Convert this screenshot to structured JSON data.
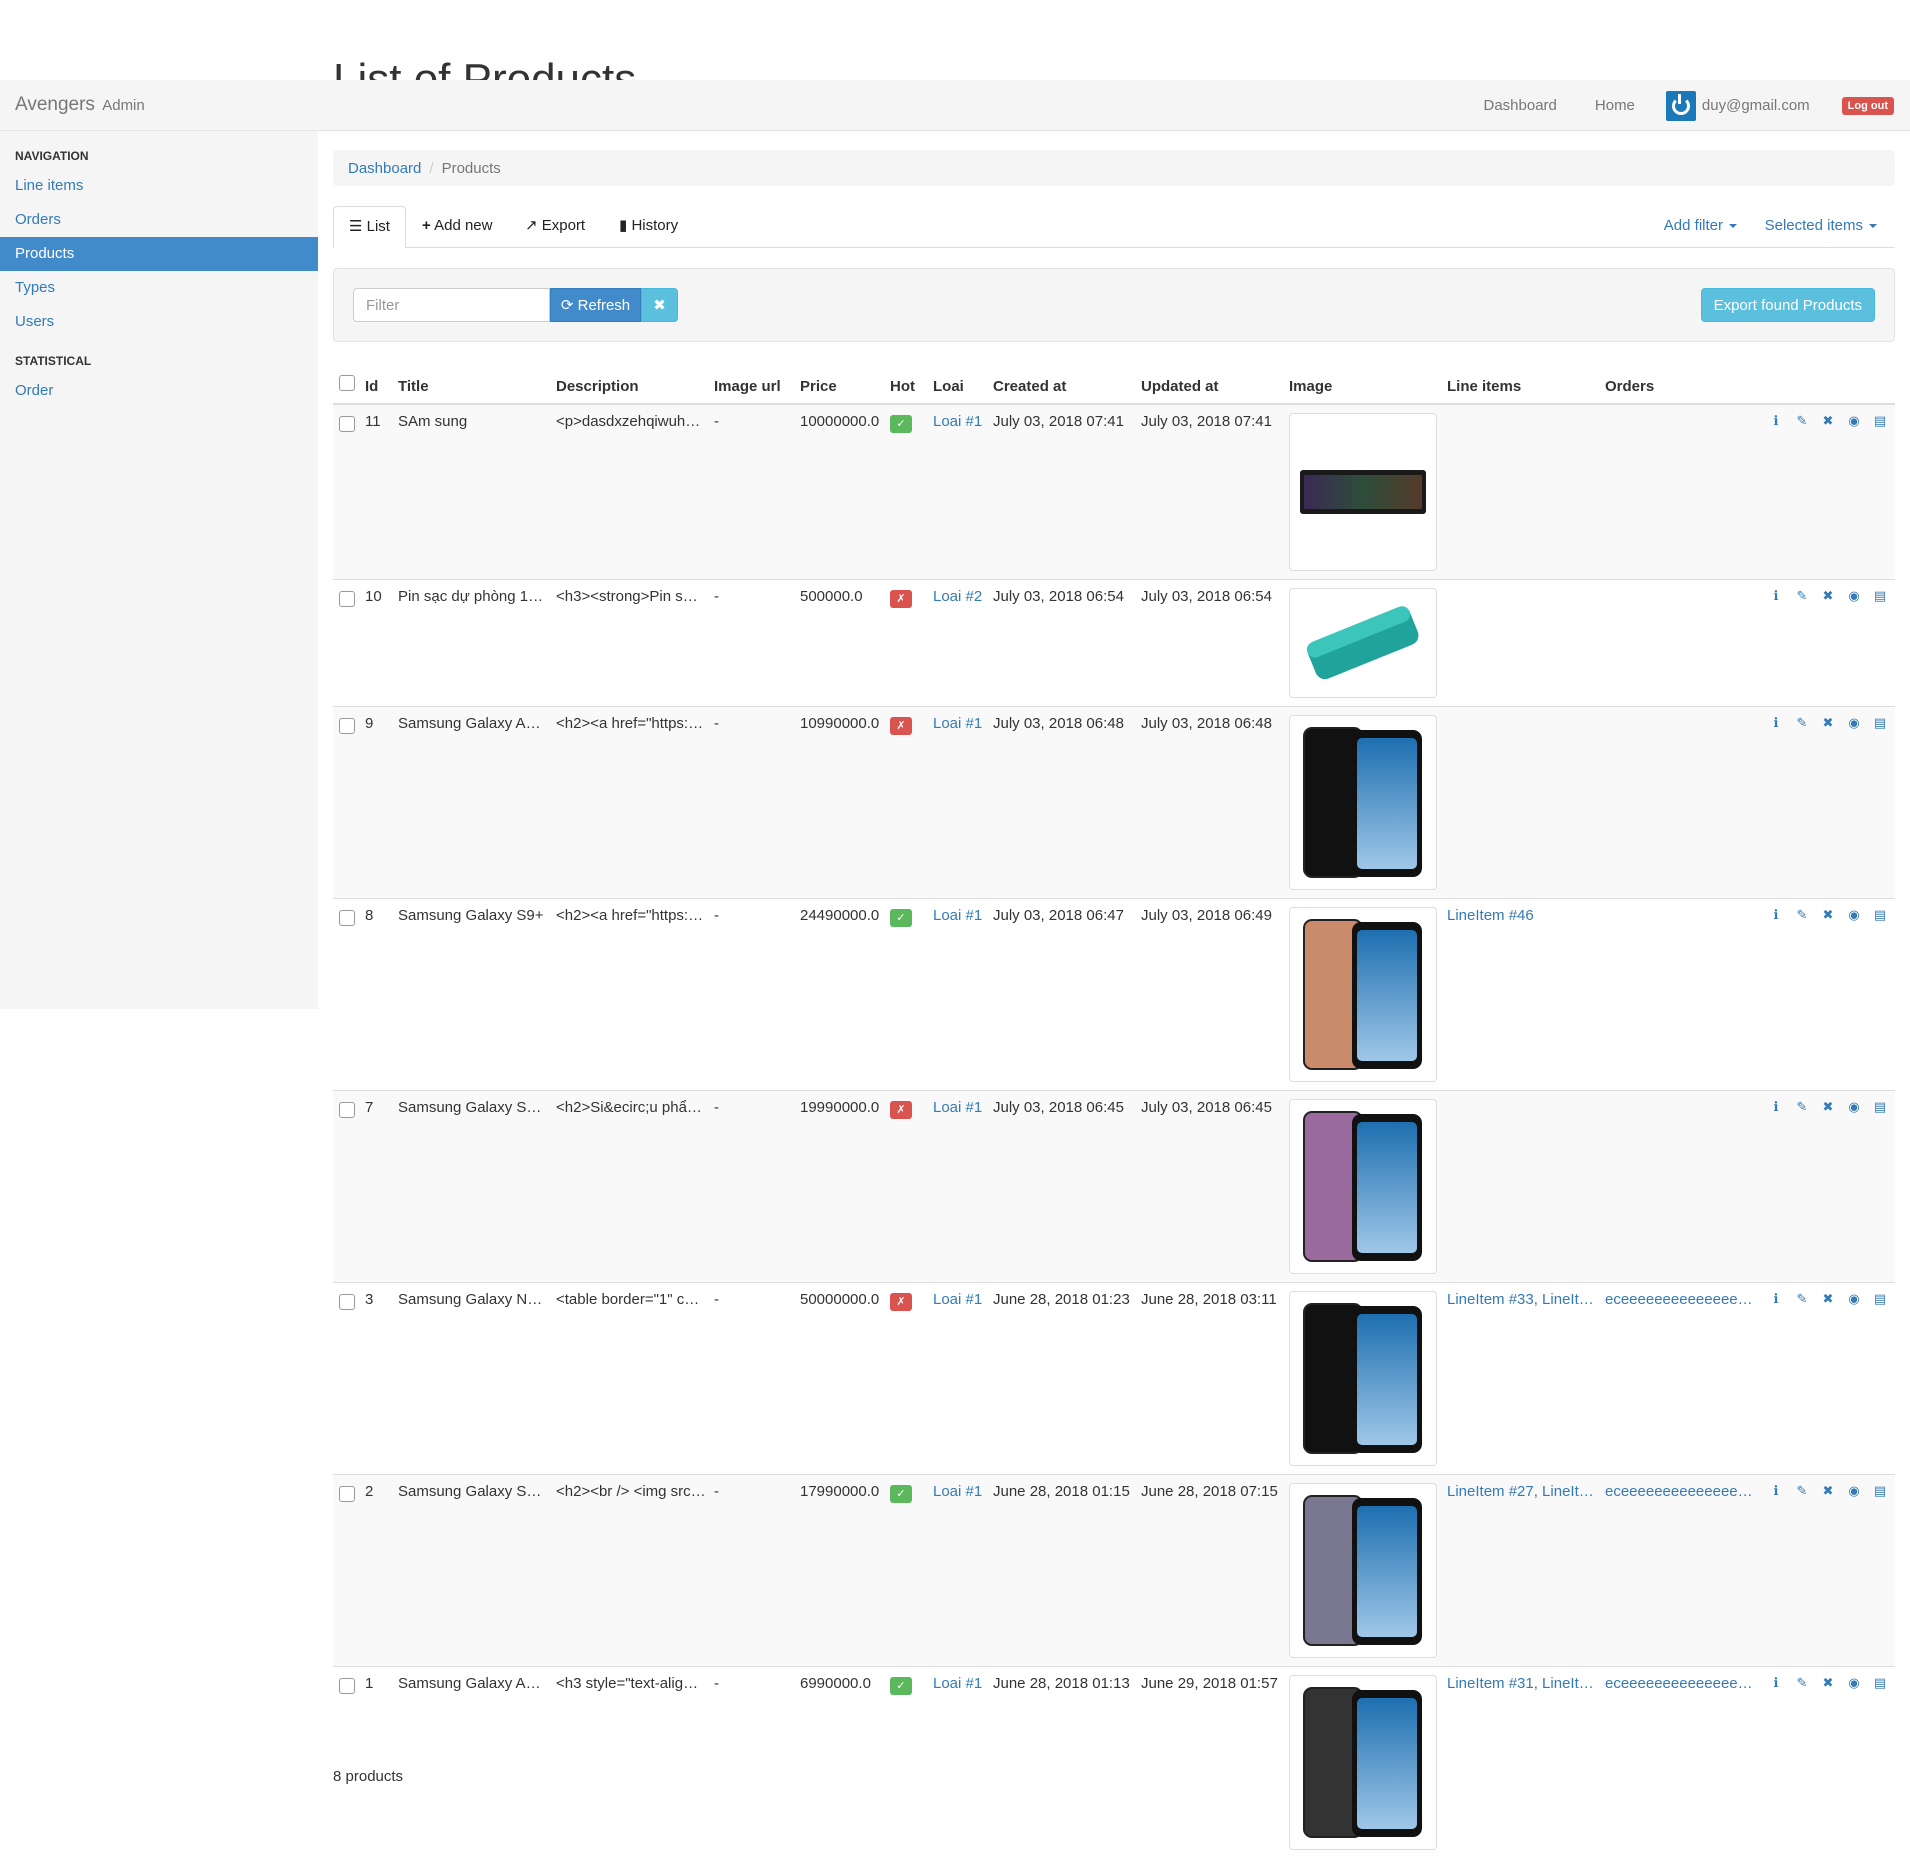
{
  "page": {
    "heading": "List of Products",
    "footer_count": "8 products"
  },
  "navbar": {
    "brand": "Avengers",
    "brand_small": "Admin",
    "links": [
      "Dashboard",
      "Home"
    ],
    "user_email": "duy@gmail.com",
    "logout_label": "Log out"
  },
  "sidebar": {
    "nav_header": "NAVIGATION",
    "items": [
      {
        "label": "Line items",
        "active": false
      },
      {
        "label": "Orders",
        "active": false
      },
      {
        "label": "Products",
        "active": true
      },
      {
        "label": "Types",
        "active": false
      },
      {
        "label": "Users",
        "active": false
      }
    ],
    "stat_header": "STATISTICAL",
    "stat_items": [
      {
        "label": "Order"
      }
    ]
  },
  "breadcrumb": {
    "root": "Dashboard",
    "current": "Products"
  },
  "tabs": {
    "list": "List",
    "add_new": "Add new",
    "export": "Export",
    "history": "History",
    "add_filter": "Add filter",
    "selected_items": "Selected items"
  },
  "filter": {
    "placeholder": "Filter",
    "refresh_label": "Refresh",
    "clear_label": "✖",
    "export_label": "Export found Products"
  },
  "table": {
    "columns": [
      "Id",
      "Title",
      "Description",
      "Image url",
      "Price",
      "Hot",
      "Loai",
      "Created at",
      "Updated at",
      "Image",
      "Line items",
      "Orders"
    ],
    "rows": [
      {
        "id": "11",
        "title": "SAm sung",
        "description": "<p>dasdxzehqiwuhe…",
        "image_url": "-",
        "price": "10000000.0",
        "hot": true,
        "loai": "Loai #1",
        "created": "July 03, 2018 07:41",
        "updated": "July 03, 2018 07:41",
        "image": "keyboard",
        "line_items": "",
        "orders": ""
      },
      {
        "id": "10",
        "title": "Pin sạc dự phòng 10…",
        "description": "<h3><strong>Pin sạ…",
        "image_url": "-",
        "price": "500000.0",
        "hot": false,
        "loai": "Loai #2",
        "created": "July 03, 2018 06:54",
        "updated": "July 03, 2018 06:54",
        "image": "powerbank",
        "line_items": "",
        "orders": ""
      },
      {
        "id": "9",
        "title": "Samsung Galaxy A8 …",
        "description": "<h2><a href=\"https://…",
        "image_url": "-",
        "price": "10990000.0",
        "hot": false,
        "loai": "Loai #1",
        "created": "July 03, 2018 06:48",
        "updated": "July 03, 2018 06:48",
        "image": "phone-black-blue",
        "line_items": "",
        "orders": ""
      },
      {
        "id": "8",
        "title": "Samsung Galaxy S9+",
        "description": "<h2><a href=\"https://…",
        "image_url": "-",
        "price": "24490000.0",
        "hot": true,
        "loai": "Loai #1",
        "created": "July 03, 2018 06:47",
        "updated": "July 03, 2018 06:49",
        "image": "phone-gold",
        "line_items": "LineItem #46",
        "orders": ""
      },
      {
        "id": "7",
        "title": "Samsung Galaxy S9 …",
        "description": "<h2>Si&ecirc;u phẩ…",
        "image_url": "-",
        "price": "19990000.0",
        "hot": false,
        "loai": "Loai #1",
        "created": "July 03, 2018 06:45",
        "updated": "July 03, 2018 06:45",
        "image": "phone-purple",
        "line_items": "",
        "orders": ""
      },
      {
        "id": "3",
        "title": "Samsung Galaxy No…",
        "description": "<table border=\"1\" cel…",
        "image_url": "-",
        "price": "50000000.0",
        "hot": false,
        "loai": "Loai #1",
        "created": "June 28, 2018 01:23",
        "updated": "June 28, 2018 03:11",
        "image": "phone-note",
        "line_items": "LineItem #33, LineIt…",
        "orders": "eceeeeeeeeeeeeee…"
      },
      {
        "id": "2",
        "title": "Samsung Galaxy S8 …",
        "description": "<h2><br /> <img src…",
        "image_url": "-",
        "price": "17990000.0",
        "hot": true,
        "loai": "Loai #1",
        "created": "June 28, 2018 01:15",
        "updated": "June 28, 2018 07:15",
        "image": "phone-s8",
        "line_items": "LineItem #27, LineIt…",
        "orders": "eceeeeeeeeeeeeee…"
      },
      {
        "id": "1",
        "title": "Samsung Galaxy A6 …",
        "description": "<h3 style=\"text-align:…",
        "image_url": "-",
        "price": "6990000.0",
        "hot": true,
        "loai": "Loai #1",
        "created": "June 28, 2018 01:13",
        "updated": "June 29, 2018 01:57",
        "image": "phone-a6",
        "line_items": "LineItem #31, LineIt…",
        "orders": "eceeeeeeeeeeeeee…"
      }
    ]
  },
  "colors": {
    "primary": "#428bca",
    "info": "#5bc0de",
    "success": "#5cb85c",
    "danger": "#d9534f"
  }
}
